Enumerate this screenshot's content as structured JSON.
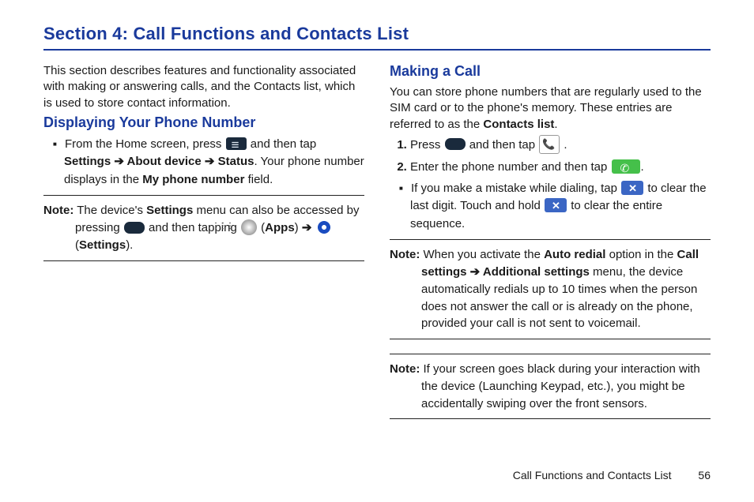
{
  "title": "Section 4: Call Functions and Contacts List",
  "left": {
    "intro": "This section describes features and functionality associated with making or answering calls, and the Contacts list, which is used to store contact information.",
    "h_display": "Displaying Your Phone Number",
    "bullet1_a": "From the Home screen, press ",
    "bullet1_b": " and then tap ",
    "bullet1_c": "Settings",
    "bullet1_d": "About device",
    "bullet1_e": "Status",
    "bullet1_f": ". Your phone number displays in the ",
    "bullet1_g": "My phone number",
    "bullet1_h": " field.",
    "note_label": "Note:",
    "note1_a": " The device's ",
    "note1_b": "Settings",
    "note1_c": " menu can also be accessed by pressing ",
    "note1_d": " and then tapping ",
    "note1_e": "Apps",
    "note1_f": "Settings"
  },
  "right": {
    "h_making": "Making a Call",
    "p1_a": "You can store phone numbers that are regularly used to the SIM card or to the phone's memory. These entries are referred to as the ",
    "p1_b": "Contacts list",
    "li1_a": "Press ",
    "li1_b": " and then tap ",
    "li2_a": "Enter the phone number and then tap ",
    "bullet_a": "If you make a mistake while dialing, tap ",
    "bullet_b": " to clear the last digit. Touch and hold ",
    "bullet_c": " to clear the entire sequence.",
    "note_label": "Note:",
    "note2_a": " When you activate the ",
    "note2_b": "Auto redial",
    "note2_c": " option in the ",
    "note2_d": "Call settings",
    "note2_e": "Additional settings",
    "note2_f": " menu, the device automatically redials up to 10 times when the person does not answer the call or is already on the phone, provided your call is not sent to voicemail.",
    "note3": " If your screen goes black during your interaction with the device (Launching Keypad, etc.), you might be accidentally swiping over the front sensors."
  },
  "footer": {
    "text": "Call Functions and Contacts List",
    "page": "56"
  },
  "arrow": " ➔ "
}
